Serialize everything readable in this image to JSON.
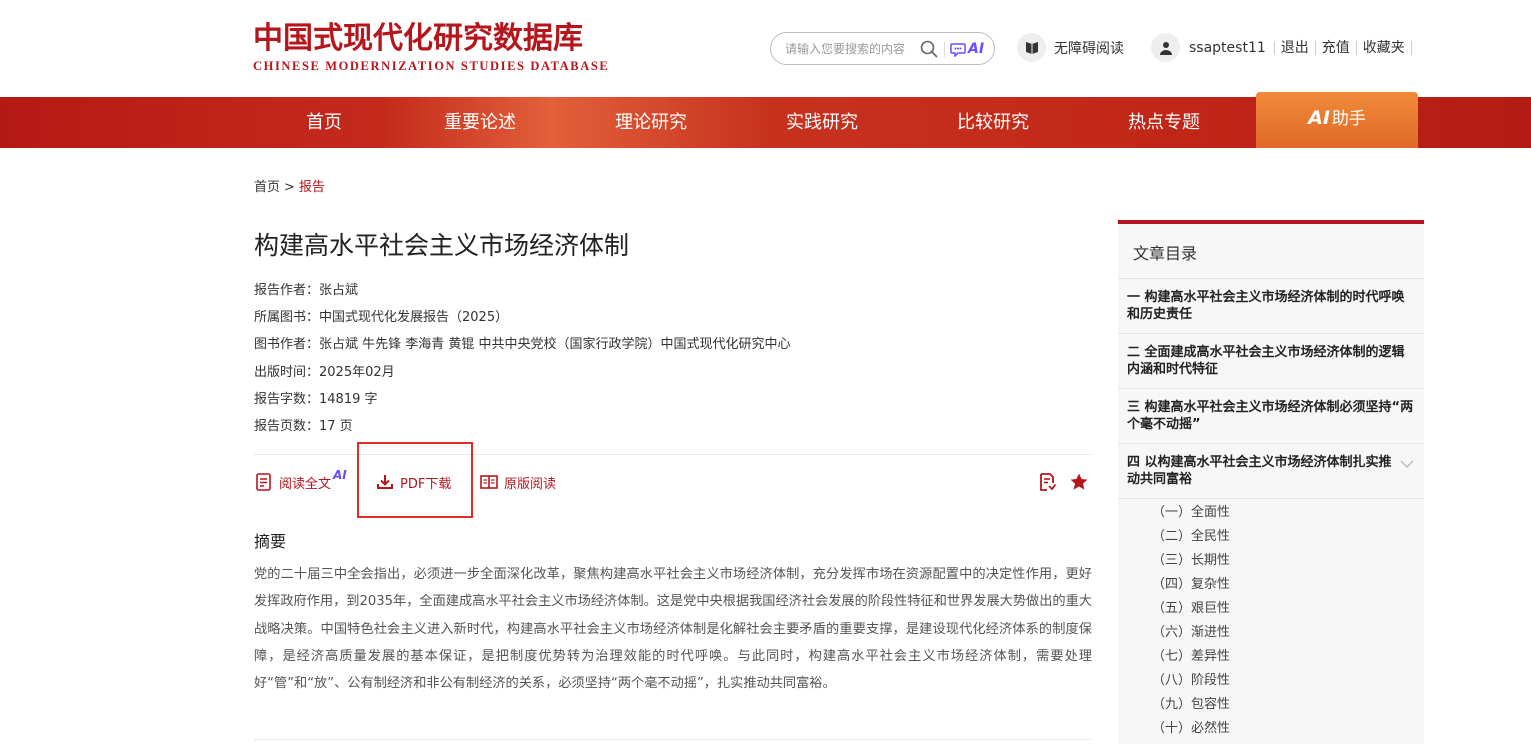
{
  "brand": {
    "cn": "中国式现代化研究数据库",
    "en": "CHINESE MODERNIZATION STUDIES DATABASE",
    "color": "#b5161c"
  },
  "search": {
    "placeholder": "请输入您要搜索的内容",
    "icon": "search-icon",
    "ai_label": "AI"
  },
  "header": {
    "accessibility_label": "无障碍阅读",
    "username": "ssaptest11",
    "links": [
      "退出",
      "充值",
      "收藏夹"
    ]
  },
  "nav": {
    "items": [
      "首页",
      "重要论述",
      "理论研究",
      "实践研究",
      "比较研究",
      "热点专题"
    ],
    "ai_prefix": "AI",
    "ai_label": "助手",
    "accent": "#e06a27"
  },
  "breadcrumb": {
    "home": "首页",
    "separator": ">",
    "current": "报告"
  },
  "article": {
    "title": "构建高水平社会主义市场经济体制",
    "meta": [
      "报告作者：张占斌",
      "所属图书：中国式现代化发展报告（2025）",
      "图书作者：张占斌 牛先锋 李海青 黄锟 中共中央党校（国家行政学院）中国式现代化研究中心",
      "出版时间：2025年02月",
      "报告字数：14819 字",
      "报告页数：17 页"
    ],
    "actions": {
      "read_full": "阅读全文",
      "read_full_ai": "AI",
      "pdf_download": "PDF下载",
      "original_read": "原版阅读"
    },
    "abstract_title": "摘要",
    "abstract": "党的二十届三中全会指出，必须进一步全面深化改革，聚焦构建高水平社会主义市场经济体制，充分发挥市场在资源配置中的决定性作用，更好发挥政府作用，到2035年，全面建成高水平社会主义市场经济体制。这是党中央根据我国经济社会发展的阶段性特征和世界发展大势做出的重大战略决策。中国特色社会主义进入新时代，构建高水平社会主义市场经济体制是化解社会主要矛盾的重要支撑，是建设现代化经济体系的制度保障，是经济高质量发展的基本保证，是把制度优势转为治理效能的时代呼唤。与此同时，构建高水平社会主义市场经济体制，需要处理好“管”和“放”、公有制经济和非公有制经济的关系，必须坚持“两个毫不动摇”，扎实推动共同富裕。"
  },
  "toc": {
    "title": "文章目录",
    "items": [
      "一 构建高水平社会主义市场经济体制的时代呼唤和历史责任",
      "二 全面建成高水平社会主义市场经济体制的逻辑内涵和时代特征",
      "三 构建高水平社会主义市场经济体制必须坚持“两个毫不动摇”",
      "四 以构建高水平社会主义市场经济体制扎实推动共同富裕"
    ],
    "sub_items": [
      "（一）全面性",
      "（二）全民性",
      "（三）长期性",
      "（四）复杂性",
      "（五）艰巨性",
      "（六）渐进性",
      "（七）差异性",
      "（八）阶段性",
      "（九）包容性",
      "（十）必然性"
    ]
  }
}
